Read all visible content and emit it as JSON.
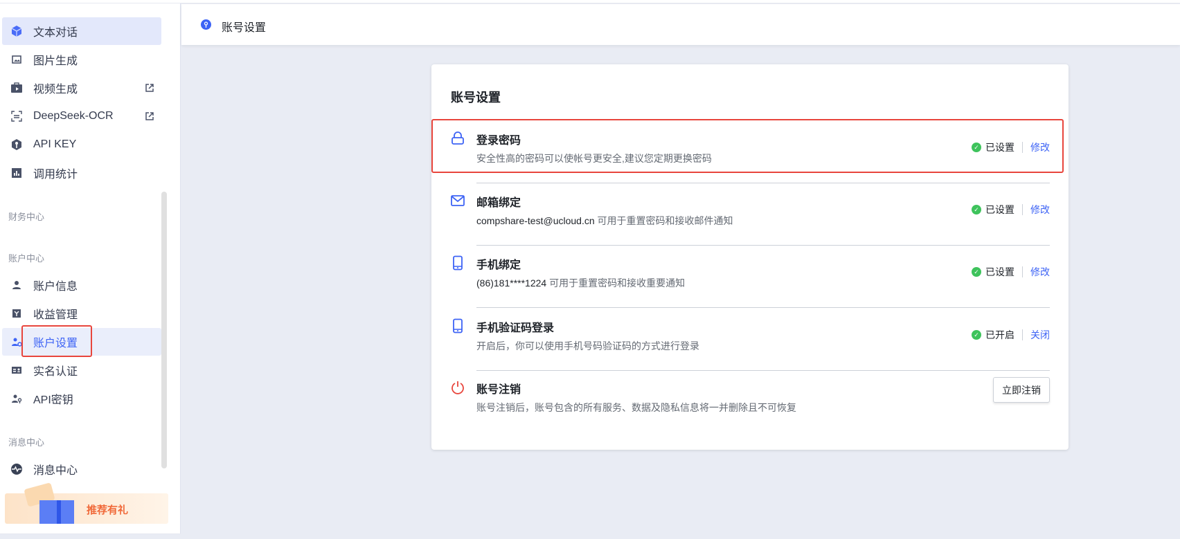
{
  "sidebar": {
    "items_top": [
      {
        "label": "文本对话",
        "icon": "cube-icon"
      },
      {
        "label": "图片生成",
        "icon": "image-icon"
      },
      {
        "label": "视频生成",
        "icon": "video-icon",
        "external": true
      },
      {
        "label": "DeepSeek-OCR",
        "icon": "scan-icon",
        "external": true
      },
      {
        "label": "API KEY",
        "icon": "key-shield-icon"
      },
      {
        "label": "调用统计",
        "icon": "bar-chart-icon"
      }
    ],
    "section_finance": "财务中心",
    "section_account": "账户中心",
    "items_account": [
      {
        "label": "账户信息",
        "icon": "user-icon"
      },
      {
        "label": "收益管理",
        "icon": "wallet-icon"
      },
      {
        "label": "账户设置",
        "icon": "user-gear-icon"
      },
      {
        "label": "实名认证",
        "icon": "id-card-icon"
      },
      {
        "label": "API密钥",
        "icon": "user-key-icon"
      }
    ],
    "section_message": "消息中心",
    "items_message": [
      {
        "label": "消息中心",
        "icon": "pulse-icon"
      }
    ],
    "banner": "推荐有礼"
  },
  "header": {
    "title": "账号设置"
  },
  "card": {
    "title": "账号设置",
    "rows": [
      {
        "title": "登录密码",
        "desc": "安全性高的密码可以使帐号更安全,建议您定期更换密码",
        "status": "已设置",
        "action": "修改"
      },
      {
        "title": "邮箱绑定",
        "value": "compshare-test@ucloud.cn",
        "desc": " 可用于重置密码和接收邮件通知",
        "status": "已设置",
        "action": "修改"
      },
      {
        "title": "手机绑定",
        "value": "(86)181****1224",
        "desc": " 可用于重置密码和接收重要通知",
        "status": "已设置",
        "action": "修改"
      },
      {
        "title": "手机验证码登录",
        "desc": "开启后，你可以使用手机号码验证码的方式进行登录",
        "status": "已开启",
        "action": "关闭"
      },
      {
        "title": "账号注销",
        "desc": "账号注销后，账号包含的所有服务、数据及隐私信息将一并删除且不可恢复",
        "button": "立即注销"
      }
    ]
  },
  "colors": {
    "accent": "#3d63f5",
    "success": "#3ec35c",
    "danger": "#e8453c",
    "highlight": "#e8453c"
  }
}
